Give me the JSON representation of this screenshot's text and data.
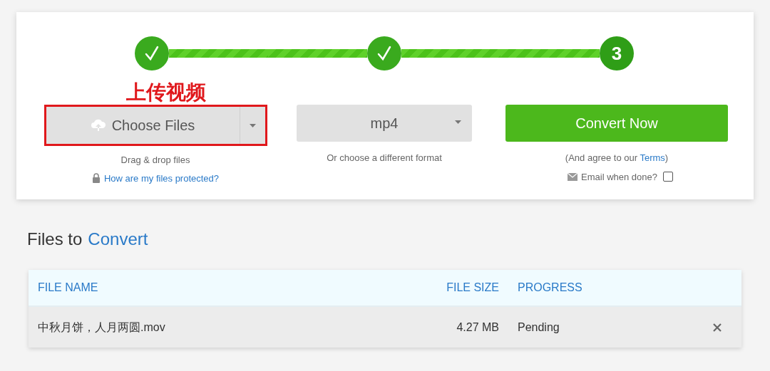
{
  "stepper": [
    {
      "done": true
    },
    {
      "done": true
    },
    {
      "done": false,
      "label": "3"
    }
  ],
  "annotation": {
    "text": "上传视频"
  },
  "upload": {
    "button": "Choose Files",
    "hint": "Drag & drop files",
    "link": "How are my files protected?"
  },
  "format": {
    "value": "mp4",
    "hint": "Or choose a different format"
  },
  "convert": {
    "button": "Convert Now",
    "terms_before": "(And agree to our ",
    "terms_link": "Terms",
    "terms_after": ")",
    "email_label": "Email when done?",
    "email_checked": false
  },
  "heading": {
    "text": "Files to",
    "highlight": "Convert"
  },
  "table": {
    "columns": [
      "FILE NAME",
      "FILE SIZE",
      "PROGRESS"
    ],
    "rows": [
      {
        "name": "中秋月饼，人月两圆.mov",
        "size": "4.27 MB",
        "progress": "Pending"
      }
    ]
  }
}
